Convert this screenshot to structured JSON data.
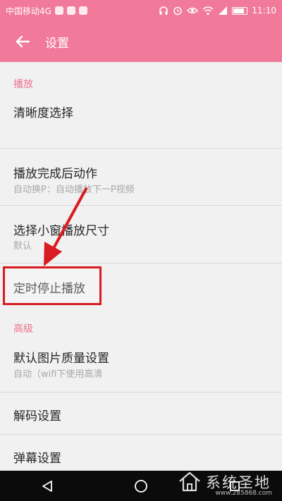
{
  "status_bar": {
    "carrier": "中国移动4G",
    "time": "11:10",
    "icons": [
      "notification-icon",
      "notification-icon",
      "notification-icon",
      "headphones-icon",
      "alarm-icon",
      "eye-icon",
      "wifi-icon",
      "signal-icon",
      "battery-icon"
    ]
  },
  "app_bar": {
    "title": "设置",
    "back_icon": "arrow-left-icon",
    "background": "#f17a9b"
  },
  "sections": {
    "playback": "播放",
    "advanced": "高级"
  },
  "items": {
    "clarity": {
      "title": "清晰度选择"
    },
    "after_complete": {
      "title": "播放完成后动作",
      "subtitle": "自动换P：自动播放下一P视频"
    },
    "mini_window_size": {
      "title": "选择小窗播放尺寸",
      "subtitle": "默认"
    },
    "timer_stop": {
      "title": "定时停止播放"
    },
    "image_quality": {
      "title": "默认图片质量设置",
      "subtitle": "自动（wifi下使用高清"
    },
    "decoding": {
      "title": "解码设置"
    },
    "danmaku": {
      "title": "弹幕设置"
    }
  },
  "accent_color": "#ee6f8f",
  "highlight_color": "#d81c22",
  "watermark": {
    "name": "系统圣地",
    "url": "www.285868.com"
  }
}
